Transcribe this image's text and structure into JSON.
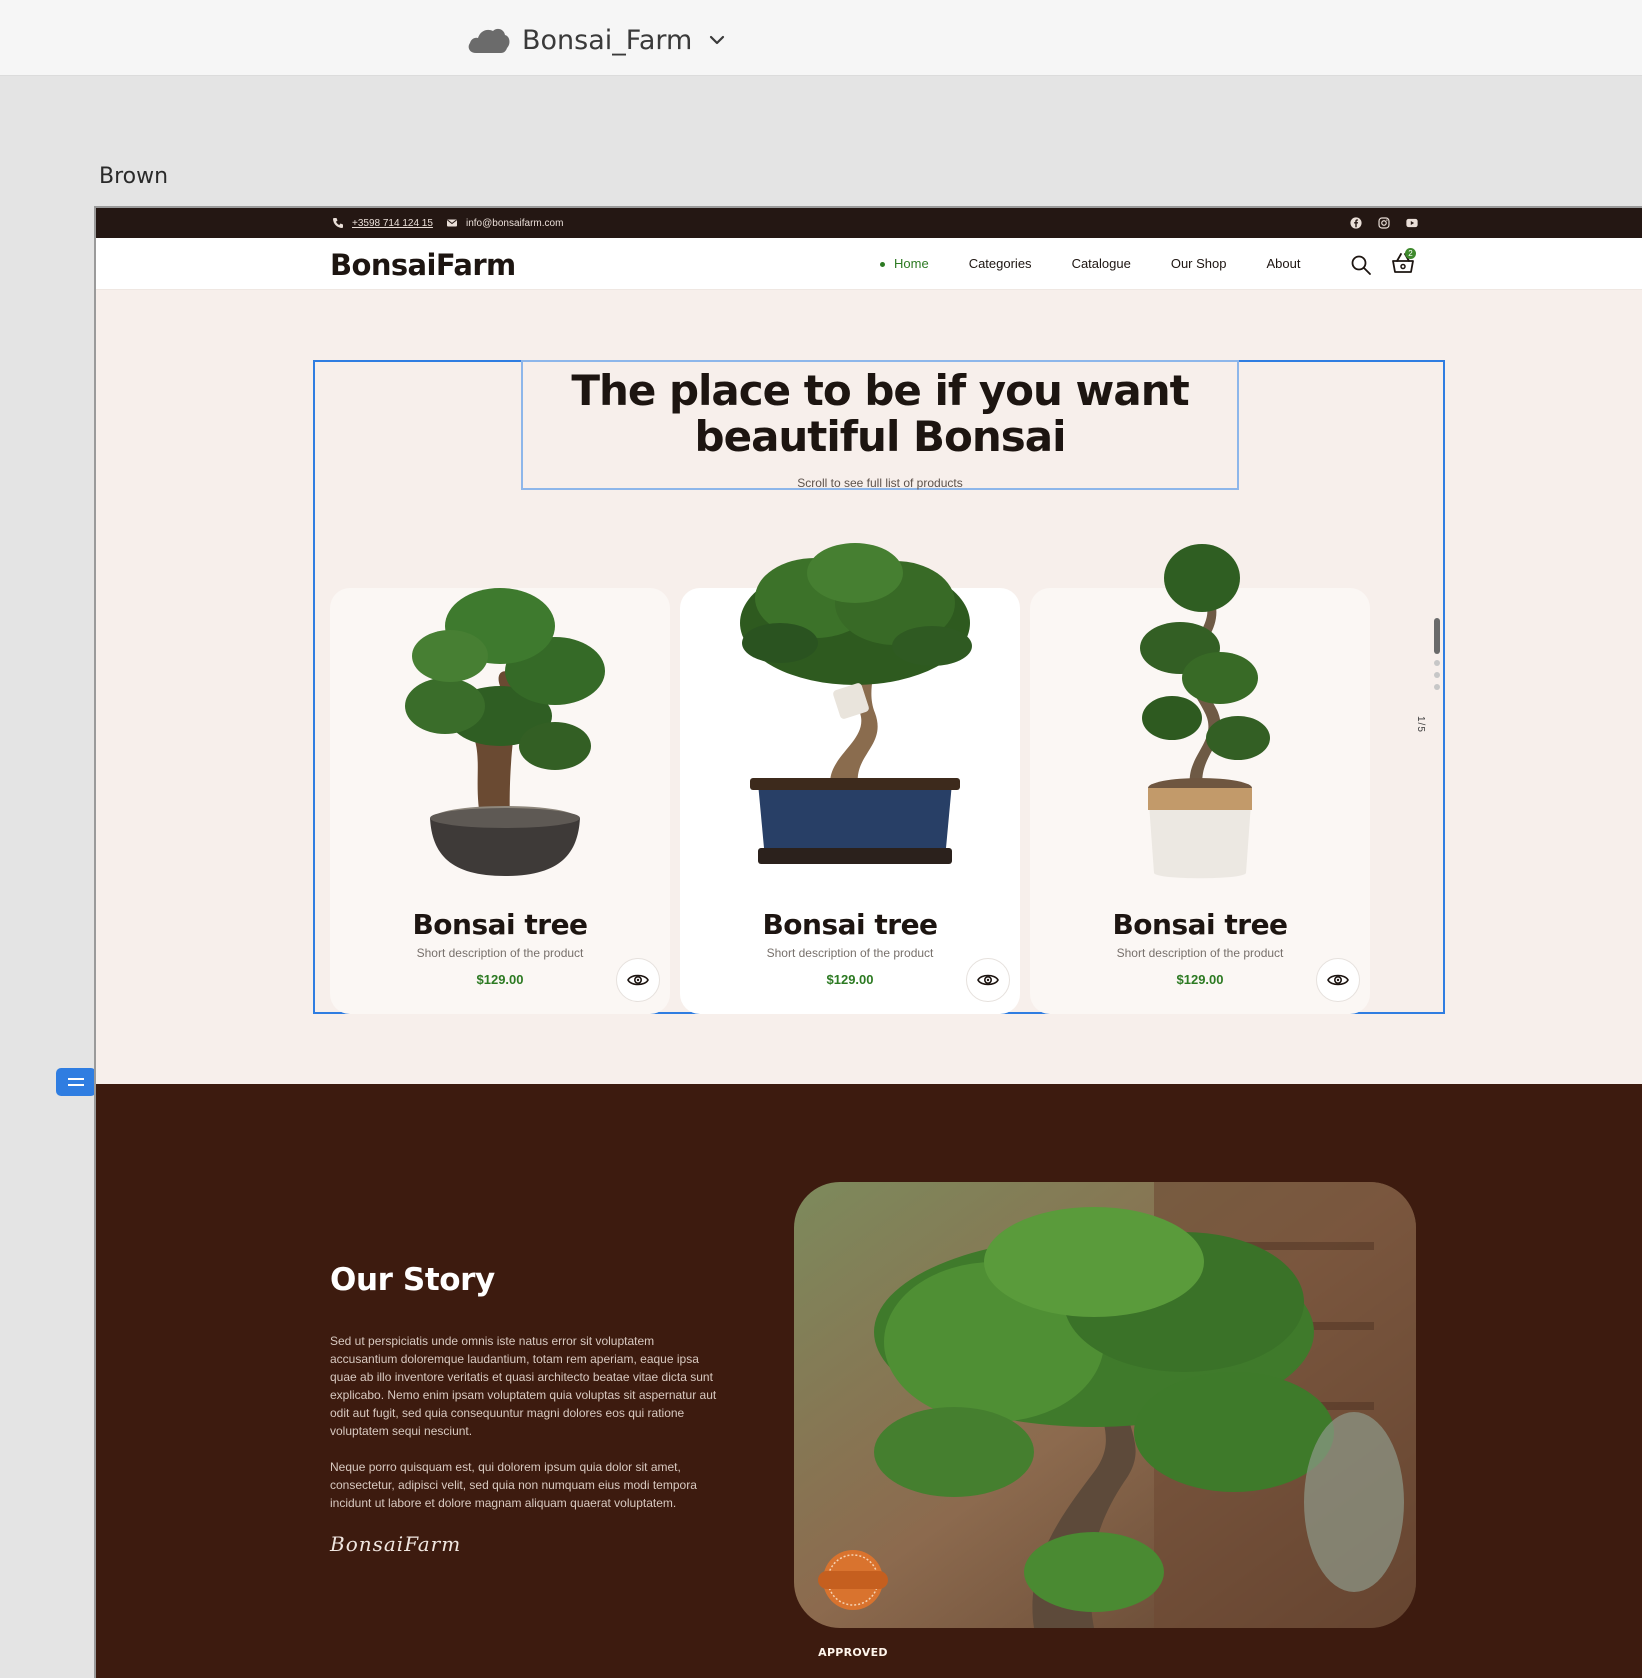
{
  "editor": {
    "project_name": "Bonsai_Farm",
    "frame_label": "Brown"
  },
  "topbar": {
    "phone": "+3598 714 124 15",
    "email": "info@bonsaifarm.com",
    "social": [
      "facebook-icon",
      "instagram-icon",
      "youtube-icon"
    ]
  },
  "header": {
    "logo": "BonsaiFarm",
    "nav": [
      {
        "label": "Home",
        "active": true
      },
      {
        "label": "Categories"
      },
      {
        "label": "Catalogue"
      },
      {
        "label": "Our Shop"
      },
      {
        "label": "About"
      }
    ],
    "cart_count": "2"
  },
  "hero": {
    "title": "The place to be if you want beautiful Bonsai",
    "subtitle": "Scroll to see full list of products",
    "pager": "1/5"
  },
  "products": [
    {
      "title": "Bonsai tree",
      "description": "Short description of the product",
      "price": "$129.00"
    },
    {
      "title": "Bonsai tree",
      "description": "Short description of the product",
      "price": "$129.00"
    },
    {
      "title": "Bonsai tree",
      "description": "Short description of the product",
      "price": "$129.00"
    }
  ],
  "story": {
    "title": "Our Story",
    "paragraph1": "Sed ut perspiciatis unde omnis iste natus error sit voluptatem accusantium doloremque laudantium, totam rem aperiam, eaque ipsa quae ab illo inventore veritatis et quasi architecto beatae vitae dicta sunt explicabo. Nemo enim ipsam voluptatem quia voluptas sit aspernatur aut odit aut fugit, sed quia consequuntur magni dolores eos qui ratione voluptatem sequi nesciunt.",
    "paragraph2": "Neque porro quisquam est, qui dolorem ipsum quia dolor sit amet, consectetur, adipisci velit, sed quia non numquam eius modi tempora incidunt ut labore et dolore magnam aliquam quaerat voluptatem.",
    "signature": "BonsaiFarm",
    "badge": "APPROVED"
  },
  "colors": {
    "accent_green": "#2c7a22",
    "topbar_dark": "#241713",
    "story_brown": "#3d1b0f",
    "hero_bg": "#f7efeb",
    "selection_blue": "#2f7de1"
  }
}
